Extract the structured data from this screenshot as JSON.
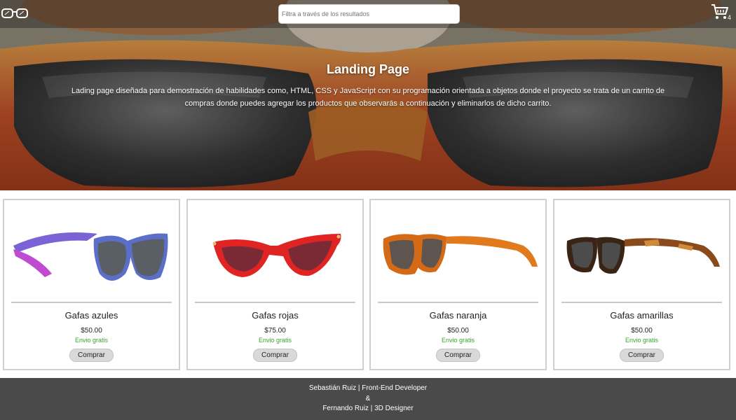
{
  "header": {
    "logo_icon": "glasses-logo-icon",
    "search": {
      "placeholder": "Filtra a través de los resultados",
      "value": ""
    },
    "cart": {
      "icon": "shopping-cart-icon",
      "count": "4"
    }
  },
  "hero": {
    "title": "Landing Page",
    "description": "Lading page diseñada para demostración de habilidades como, HTML, CSS y JavaScript con su programación orientada a objetos donde el proyecto se trata de un carrito de compras donde puedes agregar los productos que observarás a continuación y eliminarlos de dicho carrito."
  },
  "products": [
    {
      "name": "Gafas azules",
      "price": "$50.00",
      "shipping": "Envio gratis",
      "button": "Comprar",
      "frame_color": "#6a5fd0",
      "lens_color": "#5a5f66"
    },
    {
      "name": "Gafas rojas",
      "price": "$75.00",
      "shipping": "Envio gratis",
      "button": "Comprar",
      "frame_color": "#e02424",
      "lens_color": "#7a2a35"
    },
    {
      "name": "Gafas naranja",
      "price": "$50.00",
      "shipping": "Envio gratis",
      "button": "Comprar",
      "frame_color": "#d46a16",
      "lens_color": "#5e5450"
    },
    {
      "name": "Gafas amarillas",
      "price": "$50.00",
      "shipping": "Envio gratis",
      "button": "Comprar",
      "frame_color": "#3a2416",
      "lens_color": "#4c4c4c"
    }
  ],
  "footer": {
    "line1": "Sebastián Ruiz | Front-End Developer",
    "line2": "&",
    "line3": "Fernando Ruiz | 3D Designer"
  },
  "colors": {
    "shipping_green": "#3aa52f",
    "footer_bg": "#4a4a4a",
    "hero_frame_orange": "#d9782e"
  }
}
